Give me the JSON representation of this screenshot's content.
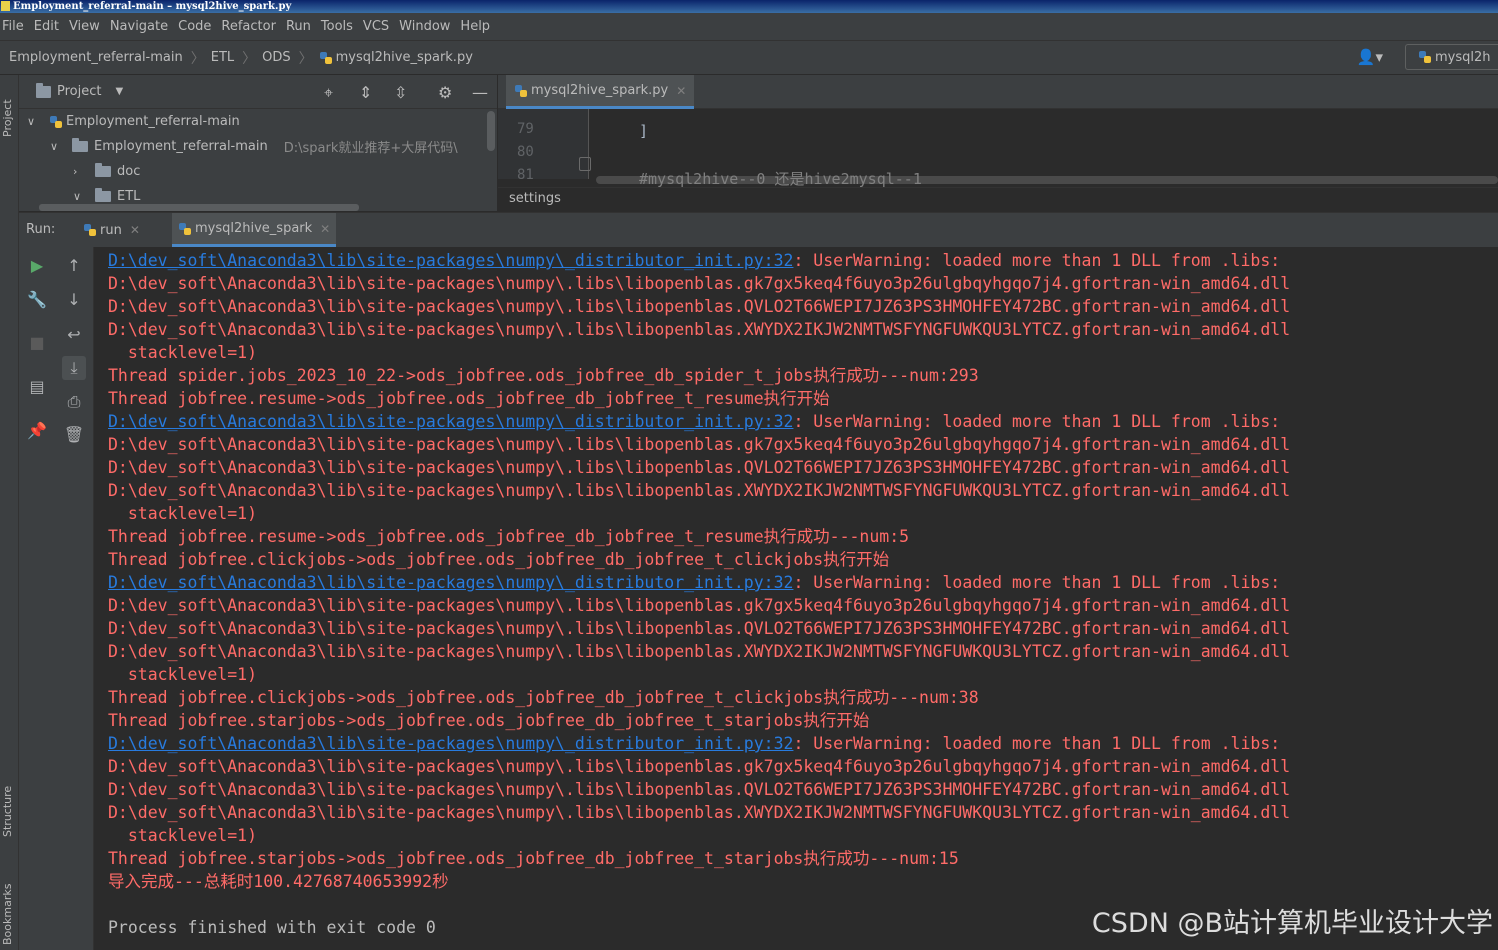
{
  "window": {
    "title": "Employment_referral-main – mysql2hive_spark.py"
  },
  "menu": [
    "File",
    "Edit",
    "View",
    "Navigate",
    "Code",
    "Refactor",
    "Run",
    "Tools",
    "VCS",
    "Window",
    "Help"
  ],
  "breadcrumb": [
    "Employment_referral-main",
    "ETL",
    "ODS",
    "mysql2hive_spark.py"
  ],
  "navbar": {
    "run_config": "mysql2h"
  },
  "left_stripe": {
    "project": "Project",
    "structure": "Structure",
    "bookmarks": "Bookmarks"
  },
  "project_panel": {
    "title": "Project",
    "tree": [
      {
        "label": "Employment_referral-main",
        "hint": ""
      },
      {
        "label": "Employment_referral-main",
        "hint": "D:\\spark就业推荐+大屏代码\\"
      },
      {
        "label": "doc",
        "hint": ""
      },
      {
        "label": "ETL",
        "hint": ""
      }
    ]
  },
  "editor": {
    "tab": "mysql2hive_spark.py",
    "line_numbers": [
      "79",
      "80",
      "81"
    ],
    "line79": "]",
    "line81": "#mysql2hive--0 还是hive2mysql--1",
    "breadcrumb": "settings"
  },
  "run": {
    "label": "Run:",
    "tabs": [
      "run",
      "mysql2hive_spark"
    ],
    "console": [
      {
        "link": "D:\\dev_soft\\Anaconda3\\lib\\site-packages\\numpy\\_distributor_init.py:32",
        "text": ": UserWarning: loaded more than 1 DLL from .libs:"
      },
      {
        "text": "D:\\dev_soft\\Anaconda3\\lib\\site-packages\\numpy\\.libs\\libopenblas.gk7gx5keq4f6uyo3p26ulgbqyhgqo7j4.gfortran-win_amd64.dll"
      },
      {
        "text": "D:\\dev_soft\\Anaconda3\\lib\\site-packages\\numpy\\.libs\\libopenblas.QVLO2T66WEPI7JZ63PS3HMOHFEY472BC.gfortran-win_amd64.dll"
      },
      {
        "text": "D:\\dev_soft\\Anaconda3\\lib\\site-packages\\numpy\\.libs\\libopenblas.XWYDX2IKJW2NMTWSFYNGFUWKQU3LYTCZ.gfortran-win_amd64.dll"
      },
      {
        "text": "  stacklevel=1)"
      },
      {
        "text": "Thread spider.jobs_2023_10_22->ods_jobfree.ods_jobfree_db_spider_t_jobs执行成功---num:293"
      },
      {
        "text": "Thread jobfree.resume->ods_jobfree.ods_jobfree_db_jobfree_t_resume执行开始"
      },
      {
        "link": "D:\\dev_soft\\Anaconda3\\lib\\site-packages\\numpy\\_distributor_init.py:32",
        "text": ": UserWarning: loaded more than 1 DLL from .libs:"
      },
      {
        "text": "D:\\dev_soft\\Anaconda3\\lib\\site-packages\\numpy\\.libs\\libopenblas.gk7gx5keq4f6uyo3p26ulgbqyhgqo7j4.gfortran-win_amd64.dll"
      },
      {
        "text": "D:\\dev_soft\\Anaconda3\\lib\\site-packages\\numpy\\.libs\\libopenblas.QVLO2T66WEPI7JZ63PS3HMOHFEY472BC.gfortran-win_amd64.dll"
      },
      {
        "text": "D:\\dev_soft\\Anaconda3\\lib\\site-packages\\numpy\\.libs\\libopenblas.XWYDX2IKJW2NMTWSFYNGFUWKQU3LYTCZ.gfortran-win_amd64.dll"
      },
      {
        "text": "  stacklevel=1)"
      },
      {
        "text": "Thread jobfree.resume->ods_jobfree.ods_jobfree_db_jobfree_t_resume执行成功---num:5"
      },
      {
        "text": "Thread jobfree.clickjobs->ods_jobfree.ods_jobfree_db_jobfree_t_clickjobs执行开始"
      },
      {
        "link": "D:\\dev_soft\\Anaconda3\\lib\\site-packages\\numpy\\_distributor_init.py:32",
        "text": ": UserWarning: loaded more than 1 DLL from .libs:"
      },
      {
        "text": "D:\\dev_soft\\Anaconda3\\lib\\site-packages\\numpy\\.libs\\libopenblas.gk7gx5keq4f6uyo3p26ulgbqyhgqo7j4.gfortran-win_amd64.dll"
      },
      {
        "text": "D:\\dev_soft\\Anaconda3\\lib\\site-packages\\numpy\\.libs\\libopenblas.QVLO2T66WEPI7JZ63PS3HMOHFEY472BC.gfortran-win_amd64.dll"
      },
      {
        "text": "D:\\dev_soft\\Anaconda3\\lib\\site-packages\\numpy\\.libs\\libopenblas.XWYDX2IKJW2NMTWSFYNGFUWKQU3LYTCZ.gfortran-win_amd64.dll"
      },
      {
        "text": "  stacklevel=1)"
      },
      {
        "text": "Thread jobfree.clickjobs->ods_jobfree.ods_jobfree_db_jobfree_t_clickjobs执行成功---num:38"
      },
      {
        "text": "Thread jobfree.starjobs->ods_jobfree.ods_jobfree_db_jobfree_t_starjobs执行开始"
      },
      {
        "link": "D:\\dev_soft\\Anaconda3\\lib\\site-packages\\numpy\\_distributor_init.py:32",
        "text": ": UserWarning: loaded more than 1 DLL from .libs:"
      },
      {
        "text": "D:\\dev_soft\\Anaconda3\\lib\\site-packages\\numpy\\.libs\\libopenblas.gk7gx5keq4f6uyo3p26ulgbqyhgqo7j4.gfortran-win_amd64.dll"
      },
      {
        "text": "D:\\dev_soft\\Anaconda3\\lib\\site-packages\\numpy\\.libs\\libopenblas.QVLO2T66WEPI7JZ63PS3HMOHFEY472BC.gfortran-win_amd64.dll"
      },
      {
        "text": "D:\\dev_soft\\Anaconda3\\lib\\site-packages\\numpy\\.libs\\libopenblas.XWYDX2IKJW2NMTWSFYNGFUWKQU3LYTCZ.gfortran-win_amd64.dll"
      },
      {
        "text": "  stacklevel=1)"
      },
      {
        "text": "Thread jobfree.starjobs->ods_jobfree.ods_jobfree_db_jobfree_t_starjobs执行成功---num:15"
      },
      {
        "text": "导入完成---总耗时100.42768740653992秒"
      },
      {
        "text": ""
      },
      {
        "text": "Process finished with exit code 0",
        "plain": true
      }
    ]
  },
  "watermark": "CSDN @B站计算机毕业设计大学",
  "colors": {
    "error": "#ff6b68",
    "link": "#287bde",
    "background": "#2b2b2b",
    "panel": "#3c3f41"
  },
  "icons": [
    "python-file-icon",
    "user-icon",
    "locate-icon",
    "expand-all-icon",
    "collapse-all-icon",
    "gear-icon",
    "minimize-icon",
    "run-icon",
    "wrench-icon",
    "stop-icon",
    "layout-icon",
    "pin-icon",
    "up-arrow-icon",
    "down-arrow-icon",
    "soft-wrap-icon",
    "scroll-to-end-icon",
    "print-icon",
    "trash-icon"
  ]
}
